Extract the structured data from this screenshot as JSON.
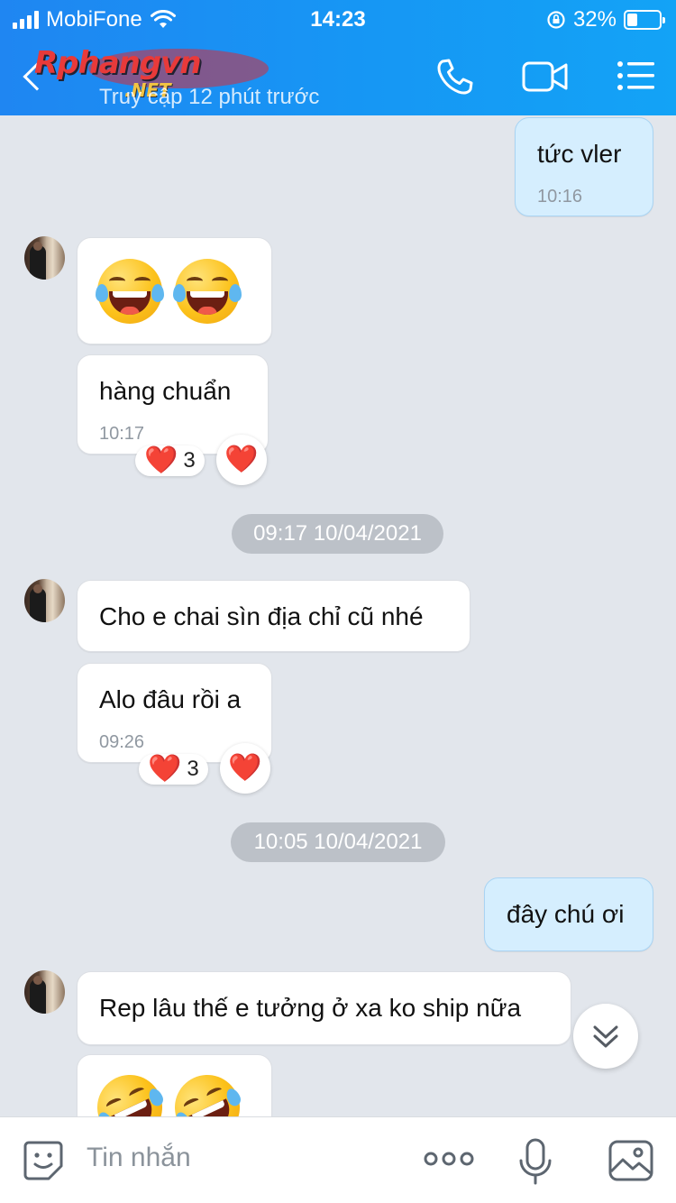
{
  "status_bar": {
    "carrier": "MobiFone",
    "time": "14:23",
    "battery": "32%",
    "battery_level": 0.32
  },
  "header": {
    "last_seen": "Truy cập 12 phút trước",
    "watermark": {
      "main": "Rphangvn",
      "sub": ".NET"
    }
  },
  "messages": [
    {
      "id": "m1",
      "direction": "out",
      "text": "tức vler",
      "time": "10:16"
    },
    {
      "id": "m2",
      "direction": "in",
      "emoji": [
        "laughing-with-tears",
        "laughing-with-tears"
      ]
    },
    {
      "id": "m3",
      "direction": "in",
      "text": "hàng chuẩn",
      "time": "10:17",
      "reaction": {
        "emoji": "❤️",
        "count": "3"
      }
    },
    {
      "id": "d1",
      "type": "date",
      "label": "09:17 10/04/2021"
    },
    {
      "id": "m4",
      "direction": "in",
      "text": "Cho e chai sìn địa chỉ cũ nhé"
    },
    {
      "id": "m5",
      "direction": "in",
      "text": "Alo đâu rồi a",
      "time": "09:26",
      "reaction": {
        "emoji": "❤️",
        "count": "3"
      }
    },
    {
      "id": "d2",
      "type": "date",
      "label": "10:05 10/04/2021"
    },
    {
      "id": "m6",
      "direction": "out",
      "text": "đây chú ơi"
    },
    {
      "id": "m7",
      "direction": "in",
      "text": "Rep lâu thế e tưởng ở xa ko ship nữa"
    },
    {
      "id": "m8",
      "direction": "in",
      "emoji": [
        "rolling-on-floor-laughing",
        "rolling-on-floor-laughing"
      ]
    }
  ],
  "input": {
    "placeholder": "Tin nhắn"
  },
  "colors": {
    "header": "#1a8ff3",
    "outgoing_bubble": "#d5eefe",
    "incoming_bubble": "#ffffff",
    "chat_background": "#e2e6ec",
    "heart": "#e8202e"
  }
}
